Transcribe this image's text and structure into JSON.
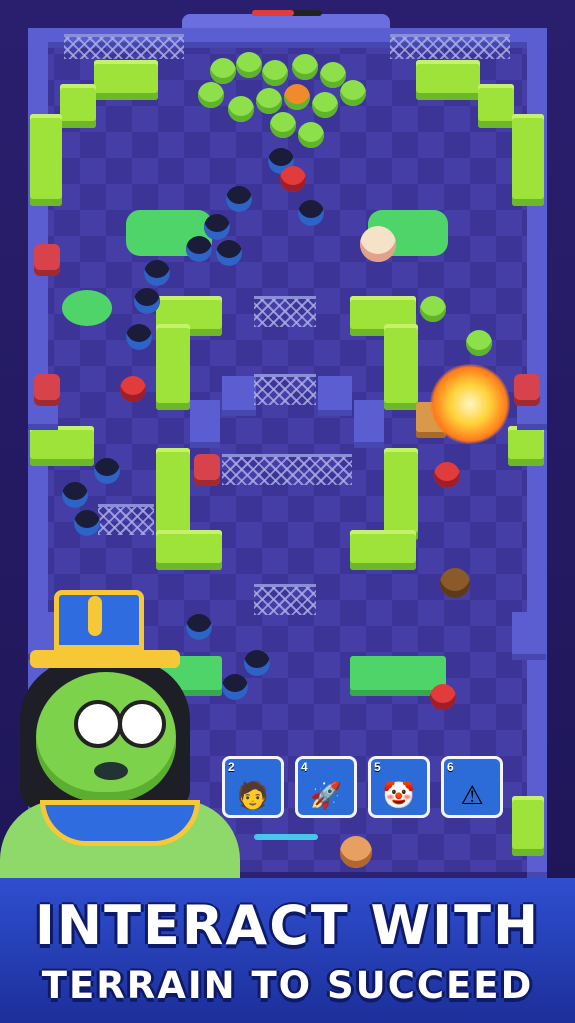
{
  "headline": {
    "line1": "INTERACT WITH",
    "line2": "TERRAIN TO SUCCEED"
  },
  "cards": [
    {
      "number": "2",
      "icon": "villager-icon",
      "glyph": "🧑"
    },
    {
      "number": "4",
      "icon": "rocket-icon",
      "glyph": "🚀"
    },
    {
      "number": "5",
      "icon": "clown-icon",
      "glyph": "🤡"
    },
    {
      "number": "6",
      "icon": "hazard-trap-icon",
      "glyph": "⚠"
    }
  ],
  "colors": {
    "grass": "#9ee33a",
    "floor": "#3c3597",
    "card_blue": "#2c6cd8",
    "banner": "#2f4fd0",
    "zombie_green": "#8ee04a"
  }
}
